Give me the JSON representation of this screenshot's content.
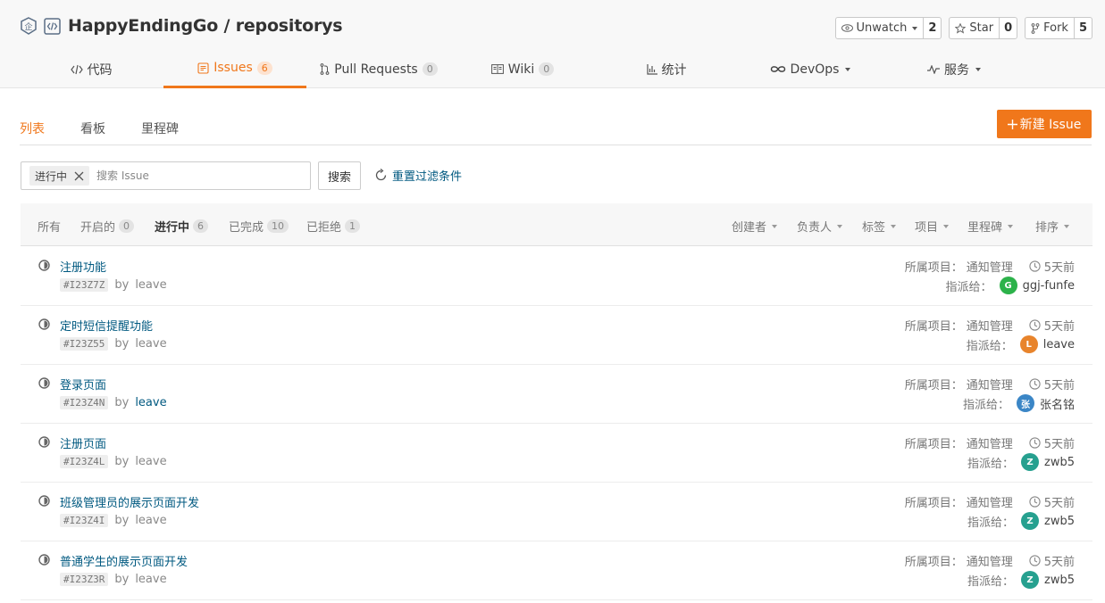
{
  "repo": {
    "owner": "HappyEndingGo",
    "separator": " / ",
    "name": "repositorys"
  },
  "actions": [
    {
      "label": "Unwatch",
      "count": "2",
      "icon": "eye-icon",
      "has_caret": true
    },
    {
      "label": "Star",
      "count": "0",
      "icon": "star-icon",
      "has_caret": false
    },
    {
      "label": "Fork",
      "count": "5",
      "icon": "fork-icon",
      "has_caret": false
    }
  ],
  "tabs": [
    {
      "label": "代码",
      "icon": "code-icon",
      "badge": ""
    },
    {
      "label": "Issues",
      "icon": "issues-icon",
      "badge": "6"
    },
    {
      "label": "Pull Requests",
      "icon": "pull-request-icon",
      "badge": "0"
    },
    {
      "label": "Wiki",
      "icon": "wiki-icon",
      "badge": "0"
    },
    {
      "label": "统计",
      "icon": "chart-icon",
      "badge": ""
    },
    {
      "label": "DevOps",
      "icon": "devops-icon",
      "badge": ""
    },
    {
      "label": "服务",
      "icon": "pulse-icon",
      "badge": ""
    }
  ],
  "subnav": {
    "items": [
      "列表",
      "看板",
      "里程碑"
    ],
    "new_button": "新建 Issue"
  },
  "search": {
    "chip": "进行中",
    "placeholder": "搜索 Issue",
    "button": "搜索",
    "reset": "重置过滤条件"
  },
  "states": [
    {
      "label": "所有",
      "badge": ""
    },
    {
      "label": "开启的",
      "badge": "0"
    },
    {
      "label": "进行中",
      "badge": "6"
    },
    {
      "label": "已完成",
      "badge": "10"
    },
    {
      "label": "已拒绝",
      "badge": "1"
    }
  ],
  "filters": [
    "创建者",
    "负责人",
    "标签",
    "项目",
    "里程碑",
    "排序"
  ],
  "labels": {
    "project": "所属项目：",
    "assign": "指派给：",
    "by": "by"
  },
  "issues": [
    {
      "title": "注册功能",
      "id": "#I23Z7Z",
      "author": "leave",
      "project": "通知管理",
      "time": "5天前",
      "assignee": "ggj-funfe",
      "avatar": "G",
      "avatar_color": "#2cb24a"
    },
    {
      "title": "定时短信提醒功能",
      "id": "#I23Z55",
      "author": "leave",
      "project": "通知管理",
      "time": "5天前",
      "assignee": "leave",
      "avatar": "L",
      "avatar_color": "#e8842c"
    },
    {
      "title": "登录页面",
      "id": "#I23Z4N",
      "author": "leave",
      "project": "通知管理",
      "time": "5天前",
      "assignee": "张名铭",
      "avatar": "张",
      "avatar_color": "#3b86c6"
    },
    {
      "title": "注册页面",
      "id": "#I23Z4L",
      "author": "leave",
      "project": "通知管理",
      "time": "5天前",
      "assignee": "zwb5",
      "avatar": "Z",
      "avatar_color": "#26a08f"
    },
    {
      "title": "班级管理员的展示页面开发",
      "id": "#I23Z4I",
      "author": "leave",
      "project": "通知管理",
      "time": "5天前",
      "assignee": "zwb5",
      "avatar": "Z",
      "avatar_color": "#26a08f"
    },
    {
      "title": "普通学生的展示页面开发",
      "id": "#I23Z3R",
      "author": "leave",
      "project": "通知管理",
      "time": "5天前",
      "assignee": "zwb5",
      "avatar": "Z",
      "avatar_color": "#26a08f"
    }
  ],
  "colors": {
    "accent": "#f0771b",
    "link": "#005980"
  }
}
